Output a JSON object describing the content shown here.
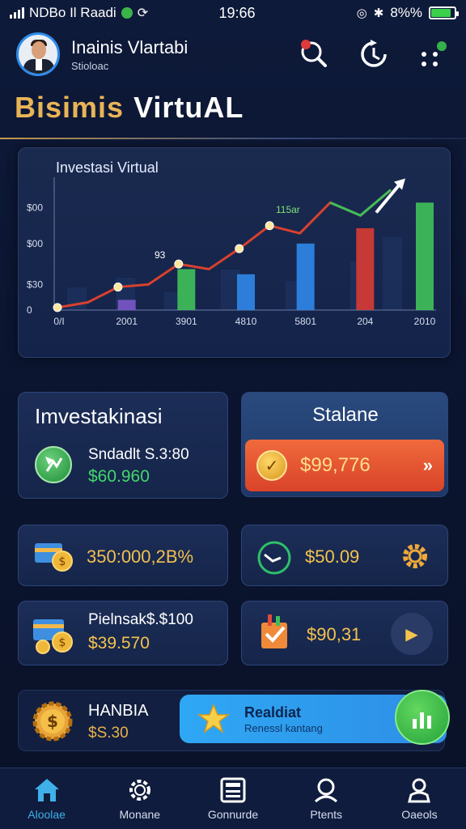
{
  "status_bar": {
    "carrier": "NDBo Il Raadi",
    "time": "19:66",
    "battery": "8%%",
    "battery_level": 0.85
  },
  "header": {
    "user_name": "Inainis Vlartabi",
    "user_subtitle": "Stioloac",
    "icons": [
      "search-icon",
      "refresh-icon",
      "menu-dots-icon"
    ]
  },
  "page_title": {
    "part1": "Bisimis",
    "part2": "VirtuAL"
  },
  "chart_card": {
    "title": "Investasi Virtual",
    "annotations": [
      "115ar",
      "93"
    ],
    "chart_data": {
      "type": "bar",
      "title": "Investasi Virtual",
      "y_tick_labels": [
        "0",
        "$30",
        "$00",
        "$00"
      ],
      "x_tick_labels": [
        "0/I",
        "2001",
        "3901",
        "4810",
        "5801",
        "204",
        "2010"
      ],
      "bars": [
        {
          "x": "2001",
          "value": 0.4,
          "color": "#7a57c7"
        },
        {
          "x": "3901",
          "value": 1.6,
          "color": "#3fbe58"
        },
        {
          "x": "4810",
          "value": 1.4,
          "color": "#2f86e6"
        },
        {
          "x": "5801",
          "value": 2.6,
          "color": "#2f86e6"
        },
        {
          "x": "204",
          "value": 3.2,
          "color": "#d63b34"
        },
        {
          "x": "2010",
          "value": 4.2,
          "color": "#3fbe58"
        }
      ],
      "line": [
        0.1,
        0.3,
        0.9,
        1.0,
        1.8,
        1.6,
        2.4,
        3.3,
        3.0,
        4.2,
        3.7,
        4.7
      ],
      "ylim": [
        0,
        5
      ],
      "grid": false
    }
  },
  "invest_card": {
    "title": "Imvestakinasi",
    "label": "Sndadlt S.3:80",
    "value": "$60.960"
  },
  "balance_card": {
    "title": "Stalane",
    "value": "$99,776"
  },
  "row2": {
    "left_value": "350:000,2B%",
    "right_value": "$50.09"
  },
  "row3": {
    "left_label": "Pielnsak$.$100",
    "left_value": "$39.570",
    "right_value": "$90,31"
  },
  "row4": {
    "left_title": "HANBIA",
    "left_value": "$S.30",
    "button_title": "Realdiat",
    "button_sub": "Renessl kantang"
  },
  "nav": {
    "items": [
      {
        "label": "Aloolae",
        "icon": "home-icon"
      },
      {
        "label": "Monane",
        "icon": "gear-icon"
      },
      {
        "label": "Gonnurde",
        "icon": "calculator-icon"
      },
      {
        "label": "Ptents",
        "icon": "user-icon"
      },
      {
        "label": "Oaeols",
        "icon": "person-icon"
      }
    ]
  }
}
